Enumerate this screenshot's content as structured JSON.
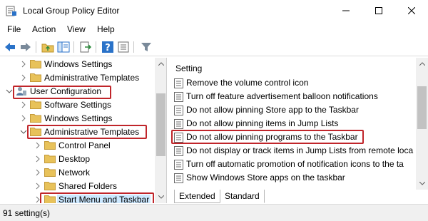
{
  "window": {
    "title": "Local Group Policy Editor"
  },
  "menu": {
    "items": [
      "File",
      "Action",
      "View",
      "Help"
    ]
  },
  "toolbar": {
    "buttons": [
      "back-icon",
      "forward-icon",
      "up-folder-icon",
      "show-hide-tree-icon",
      "export-list-icon",
      "help-icon",
      "properties-icon",
      "filter-icon"
    ]
  },
  "tree": {
    "items": [
      {
        "label": "Windows Settings",
        "expanded": false,
        "level": 2
      },
      {
        "label": "Administrative Templates",
        "expanded": false,
        "level": 2
      },
      {
        "label": "User Configuration",
        "expanded": true,
        "level": 1
      },
      {
        "label": "Software Settings",
        "expanded": false,
        "level": 2
      },
      {
        "label": "Windows Settings",
        "expanded": false,
        "level": 2
      },
      {
        "label": "Administrative Templates",
        "expanded": true,
        "level": 2
      },
      {
        "label": "Control Panel",
        "expanded": false,
        "level": 3
      },
      {
        "label": "Desktop",
        "expanded": false,
        "level": 3
      },
      {
        "label": "Network",
        "expanded": false,
        "level": 3
      },
      {
        "label": "Shared Folders",
        "expanded": false,
        "level": 3
      },
      {
        "label": "Start Menu and Taskbar",
        "expanded": false,
        "level": 3,
        "selected": true
      }
    ]
  },
  "details": {
    "column_header": "Setting",
    "rows": [
      "Remove the volume control icon",
      "Turn off feature advertisement balloon notifications",
      "Do not allow pinning Store app to the Taskbar",
      "Do not allow pinning items in Jump Lists",
      "Do not allow pinning programs to the Taskbar",
      "Do not display or track items in Jump Lists from remote loca",
      "Turn off automatic promotion of notification icons to the ta",
      "Show Windows Store apps on the taskbar"
    ]
  },
  "tabs": {
    "items": [
      "Extended",
      "Standard"
    ],
    "active": "Standard"
  },
  "status": {
    "text": "91 setting(s)"
  },
  "colors": {
    "highlight_box": "#c0252a",
    "selection": "#cce8ff",
    "folder": "#e8c25a",
    "toolbar_blue": "#2a72c8"
  }
}
